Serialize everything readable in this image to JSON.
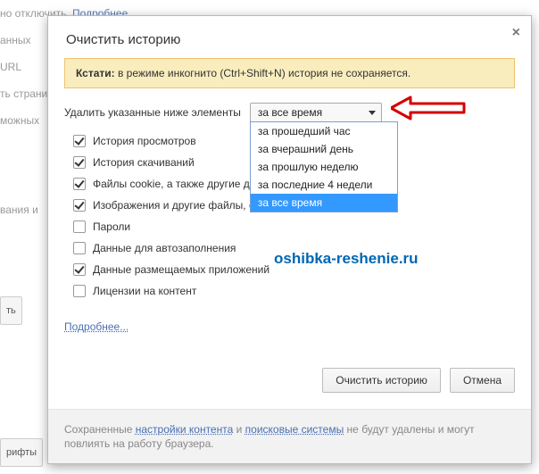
{
  "bg": {
    "line1_suffix": "но отключить.",
    "link_more": "Подробнее...",
    "line2": "анных",
    "line3": "URL",
    "line4": "ть страни",
    "line5": "можных",
    "line6": "вания и",
    "btn1": "ть",
    "btn2": "рифты"
  },
  "modal": {
    "title": "Очистить историю",
    "close": "×",
    "banner_prefix": "Кстати:",
    "banner_rest": " в режиме инкогнито (Ctrl+Shift+N) история не сохраняется.",
    "select_label": "Удалить указанные ниже элементы",
    "selected_value": "за все время",
    "options": [
      "за прошедший час",
      "за вчерашний день",
      "за прошлую неделю",
      "за последние 4 недели",
      "за все время"
    ],
    "selected_index": 4,
    "items": [
      {
        "label": "История просмотров",
        "checked": true
      },
      {
        "label": "История скачиваний",
        "checked": true
      },
      {
        "label": "Файлы cookie, а также другие данные сайтов и плагинов",
        "checked": true
      },
      {
        "label": "Изображения и другие файлы, сохраненные в кеше",
        "checked": true
      },
      {
        "label": "Пароли",
        "checked": false
      },
      {
        "label": "Данные для автозаполнения",
        "checked": false
      },
      {
        "label": "Данные размещаемых приложений",
        "checked": true
      },
      {
        "label": "Лицензии на контент",
        "checked": false
      }
    ],
    "more_link": "Подробнее...",
    "btn_clear": "Очистить историю",
    "btn_cancel": "Отмена",
    "footer_1": "Сохраненные ",
    "footer_link1": "настройки контента",
    "footer_2": " и ",
    "footer_link2": "поисковые системы",
    "footer_3": " не будут удалены и могут повлиять на работу браузера."
  },
  "watermark": "oshibka-reshenie.ru"
}
